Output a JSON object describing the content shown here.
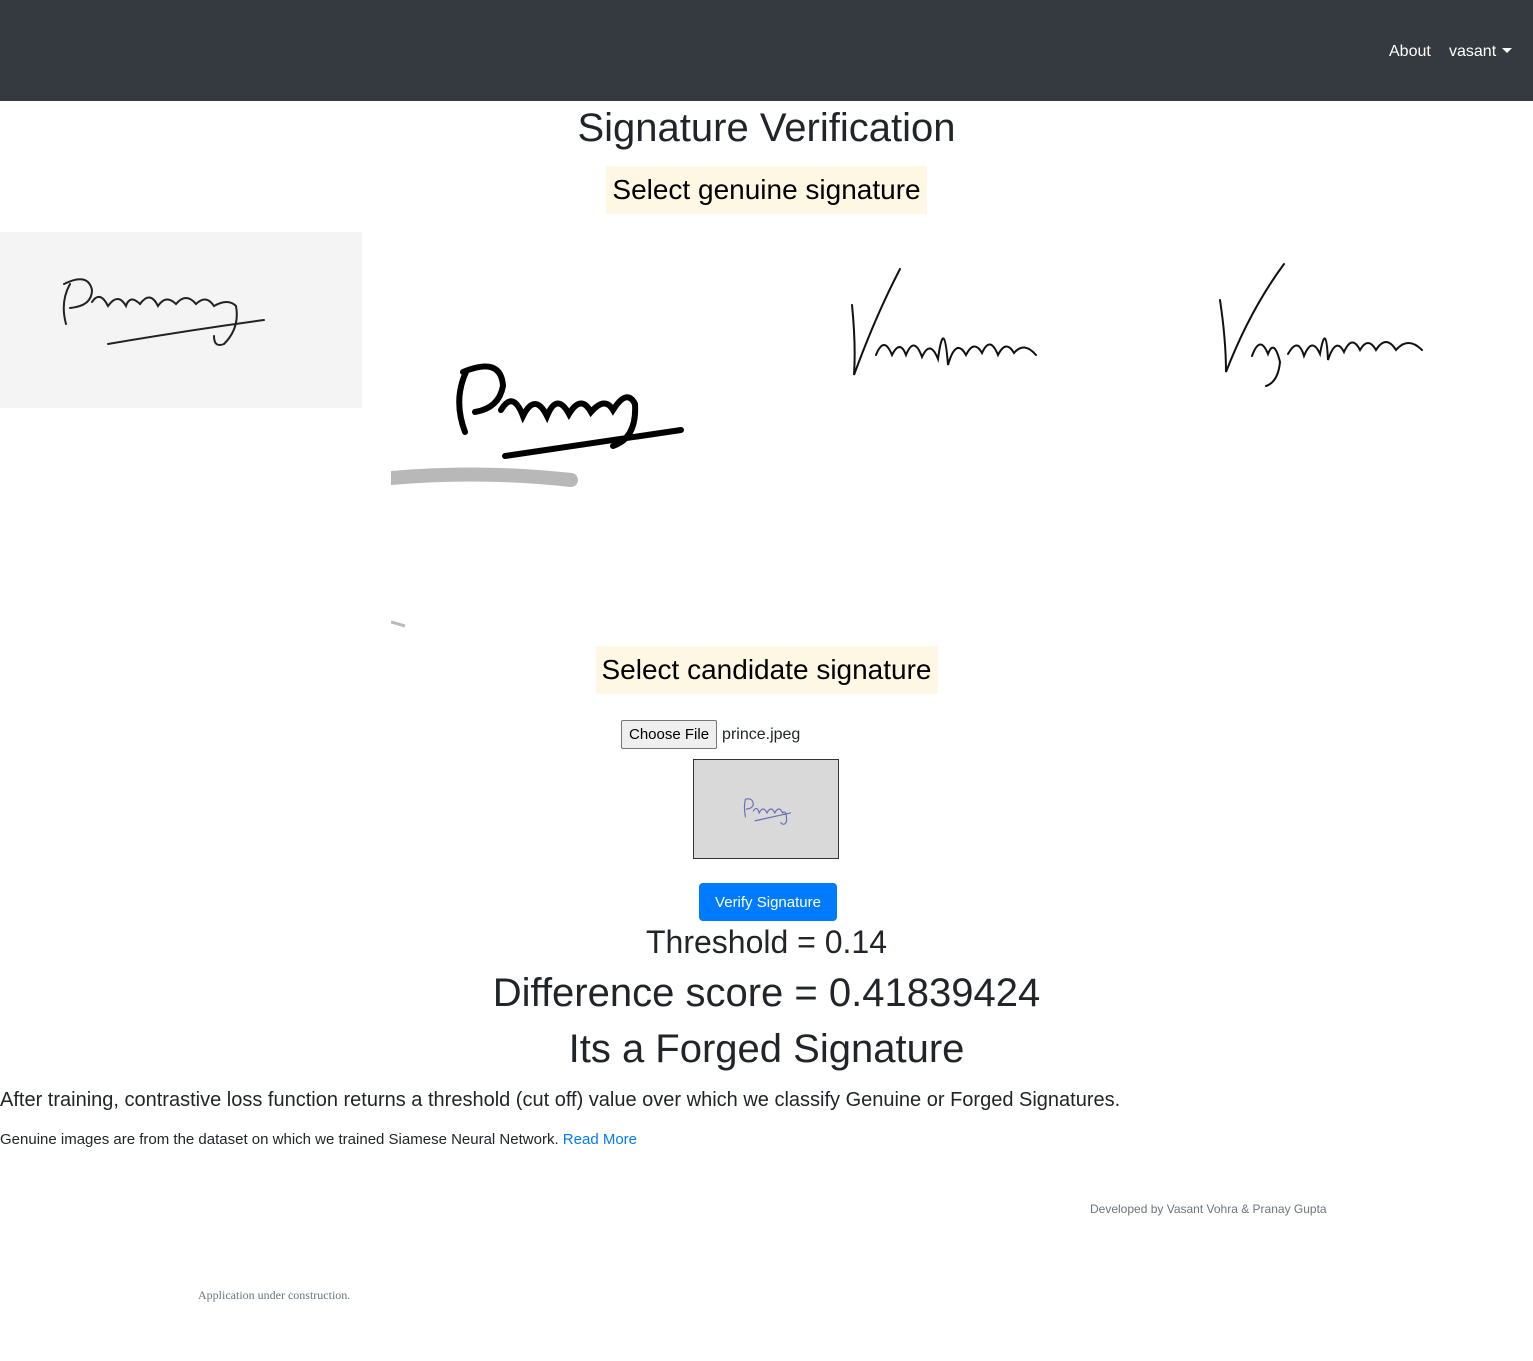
{
  "navbar": {
    "about_label": "About",
    "user_label": "vasant"
  },
  "page": {
    "title": "Signature Verification",
    "genuine_label": "Select genuine signature",
    "candidate_label": "Select candidate signature"
  },
  "genuine_signatures": [
    {
      "text": "Pranay"
    },
    {
      "text": "Pranay"
    },
    {
      "text": "Vasantvohra"
    },
    {
      "text": "Vasantvohra"
    }
  ],
  "candidate": {
    "choose_file_label": "Choose File",
    "file_name": "prince.jpeg",
    "preview_text": "Pranay"
  },
  "verify_button_label": "Verify Signature",
  "results": {
    "threshold_text": "Threshold = 0.14",
    "difference_text": "Difference score = 0.41839424",
    "verdict_text": "Its a Forged Signature"
  },
  "footer": {
    "explanation": "After training, contrastive loss function returns a threshold (cut off) value over which we classify Genuine or Forged Signatures.",
    "dataset_note": "Genuine images are from the dataset on which we trained Siamese Neural Network.",
    "read_more_label": "Read More",
    "credits": "Developed by Vasant Vohra & Pranay Gupta",
    "construction_note": "Application under construction."
  },
  "colors": {
    "navbar_bg": "#343a40",
    "label_bg": "#fdf7e3",
    "primary": "#007bff"
  }
}
